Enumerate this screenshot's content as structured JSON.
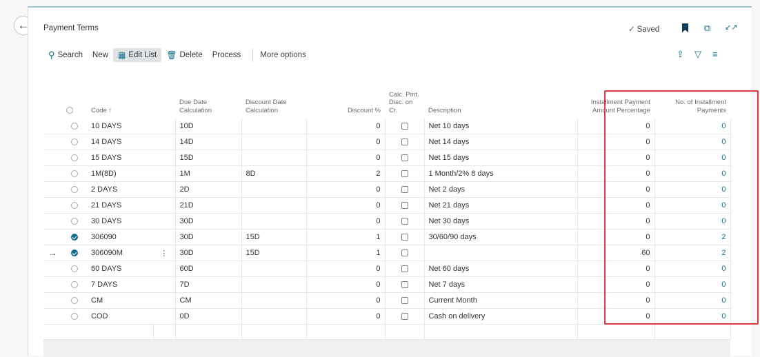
{
  "header": {
    "title": "Payment Terms",
    "saved_label": "Saved"
  },
  "icons": {
    "back": "back-arrow-icon",
    "bookmark": "bookmark-icon",
    "popout": "open-in-new-window-icon",
    "collapse": "collapse-icon",
    "share": "share-icon",
    "filter": "filter-icon",
    "list": "list-view-icon"
  },
  "actions": {
    "search": "Search",
    "new": "New",
    "edit_list": "Edit List",
    "delete": "Delete",
    "process": "Process",
    "more": "More options"
  },
  "columns": {
    "code": "Code ↑",
    "due_date": "Due Date Calculation",
    "discount_date": "Discount Date Calculation",
    "discount": "Discount %",
    "calc_pmt": "Calc. Pmt. Disc. on Cr.",
    "description": "Description",
    "installment_pct": "Installment Payment Amount Percentage",
    "installment_count": "No. of Installment Payments"
  },
  "rows": [
    {
      "code": "10 DAYS",
      "due": "10D",
      "disc_date": "",
      "discount": "0",
      "calc": false,
      "description": "Net 10 days",
      "inst_pct": "0",
      "inst_count": "0",
      "selected": false,
      "current": false
    },
    {
      "code": "14 DAYS",
      "due": "14D",
      "disc_date": "",
      "discount": "0",
      "calc": false,
      "description": "Net 14 days",
      "inst_pct": "0",
      "inst_count": "0",
      "selected": false,
      "current": false
    },
    {
      "code": "15 DAYS",
      "due": "15D",
      "disc_date": "",
      "discount": "0",
      "calc": false,
      "description": "Net 15 days",
      "inst_pct": "0",
      "inst_count": "0",
      "selected": false,
      "current": false
    },
    {
      "code": "1M(8D)",
      "due": "1M",
      "disc_date": "8D",
      "discount": "2",
      "calc": false,
      "description": "1 Month/2% 8 days",
      "inst_pct": "0",
      "inst_count": "0",
      "selected": false,
      "current": false
    },
    {
      "code": "2 DAYS",
      "due": "2D",
      "disc_date": "",
      "discount": "0",
      "calc": false,
      "description": "Net 2 days",
      "inst_pct": "0",
      "inst_count": "0",
      "selected": false,
      "current": false
    },
    {
      "code": "21 DAYS",
      "due": "21D",
      "disc_date": "",
      "discount": "0",
      "calc": false,
      "description": "Net 21 days",
      "inst_pct": "0",
      "inst_count": "0",
      "selected": false,
      "current": false
    },
    {
      "code": "30 DAYS",
      "due": "30D",
      "disc_date": "",
      "discount": "0",
      "calc": false,
      "description": "Net 30 days",
      "inst_pct": "0",
      "inst_count": "0",
      "selected": false,
      "current": false
    },
    {
      "code": "306090",
      "due": "30D",
      "disc_date": "15D",
      "discount": "1",
      "calc": false,
      "description": "30/60/90 days",
      "inst_pct": "0",
      "inst_count": "2",
      "selected": true,
      "current": false
    },
    {
      "code": "306090M",
      "due": "30D",
      "disc_date": "15D",
      "discount": "1",
      "calc": false,
      "description": "",
      "inst_pct": "60",
      "inst_count": "2",
      "selected": true,
      "current": true
    },
    {
      "code": "60 DAYS",
      "due": "60D",
      "disc_date": "",
      "discount": "0",
      "calc": false,
      "description": "Net 60 days",
      "inst_pct": "0",
      "inst_count": "0",
      "selected": false,
      "current": false
    },
    {
      "code": "7 DAYS",
      "due": "7D",
      "disc_date": "",
      "discount": "0",
      "calc": false,
      "description": "Net 7 days",
      "inst_pct": "0",
      "inst_count": "0",
      "selected": false,
      "current": false
    },
    {
      "code": "CM",
      "due": "CM",
      "disc_date": "",
      "discount": "0",
      "calc": false,
      "description": "Current Month",
      "inst_pct": "0",
      "inst_count": "0",
      "selected": false,
      "current": false
    },
    {
      "code": "COD",
      "due": "0D",
      "disc_date": "",
      "discount": "0",
      "calc": false,
      "description": "Cash on delivery",
      "inst_pct": "0",
      "inst_count": "0",
      "selected": false,
      "current": false
    }
  ],
  "colors": {
    "accent": "#0f6f8e",
    "highlight_border": "#e03a3e"
  }
}
